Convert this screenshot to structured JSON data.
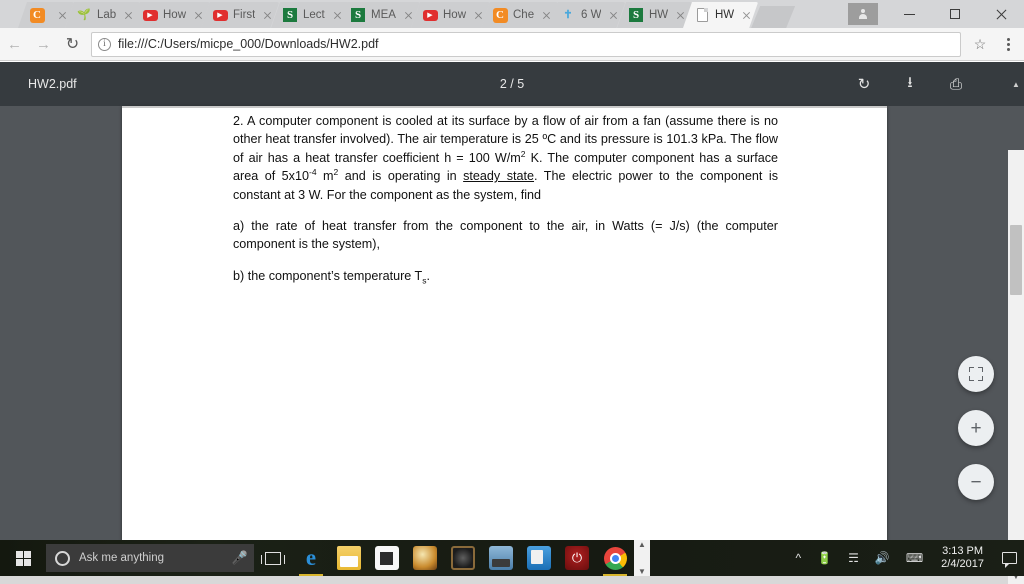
{
  "browser": {
    "tabs": [
      {
        "title": "",
        "favicon": "chegg-icon",
        "active": false
      },
      {
        "title": "Lab",
        "favicon": "lab-icon",
        "active": false
      },
      {
        "title": "How",
        "favicon": "youtube-icon",
        "active": false
      },
      {
        "title": "First",
        "favicon": "youtube-icon",
        "active": false
      },
      {
        "title": "Lect",
        "favicon": "sparknotes-icon",
        "active": false
      },
      {
        "title": "MEA",
        "favicon": "sparknotes-icon",
        "active": false
      },
      {
        "title": "How",
        "favicon": "youtube-icon",
        "active": false
      },
      {
        "title": "Che",
        "favicon": "chegg-icon",
        "active": false
      },
      {
        "title": "6 W",
        "favicon": "cross-icon",
        "active": false
      },
      {
        "title": "HW",
        "favicon": "sparknotes-icon",
        "active": false
      },
      {
        "title": "HW",
        "favicon": "document-icon",
        "active": true
      }
    ],
    "window_controls": {
      "minimize": "minimize-button",
      "maximize": "maximize-button",
      "close": "close-button",
      "profile": "profile-button"
    },
    "nav": {
      "back": "back-button",
      "forward": "forward-button",
      "reload": "reload-button",
      "bookmark": "bookmark-star",
      "menu": "chrome-menu"
    },
    "omnibox": {
      "url": "file:///C:/Users/micpe_000/Downloads/HW2.pdf",
      "security_icon": "info-icon"
    }
  },
  "pdf": {
    "filename": "HW2.pdf",
    "page_indicator": "2 / 5",
    "current_page": 2,
    "total_pages": 5,
    "tools": {
      "rotate": "rotate-icon",
      "download": "download-icon",
      "print": "print-icon"
    },
    "zoom_controls": {
      "fit": "fit-to-page-button",
      "zoom_in": "+",
      "zoom_out": "−"
    },
    "content": {
      "problem_number": "2.",
      "paragraph_1_a": "2. A computer component is cooled at its surface by a flow of air from a fan (assume there is no other heat transfer involved). The air temperature is 25 ",
      "paragraph_1_b": "C and its pressure is 101.3 kPa. The flow of air has a heat transfer coefficient h = 100 W/m",
      "paragraph_1_c": " K. The computer component has a surface area of 5x10",
      "paragraph_1_d": " m",
      "paragraph_1_e": " and is operating in ",
      "steady_state": "steady state",
      "paragraph_1_f": ". The electric power to the component is constant at 3 W. For the component as the system, find",
      "degree_symbol": "º",
      "exp_2": "2",
      "exp_neg4": "-4",
      "part_a": "a) the rate of heat transfer from the component to the air, in Watts (= J/s) (the computer component is the system),",
      "part_b_pre": "b) the component’s temperature T",
      "part_b_sub": "s",
      "part_b_post": "."
    }
  },
  "taskbar": {
    "start": "start-button",
    "search": {
      "placeholder": "Ask me anything",
      "mic": "microphone-icon",
      "cortana": "cortana-circle"
    },
    "task_view": "task-view-button",
    "pinned": [
      {
        "name": "microsoft-edge",
        "running": true
      },
      {
        "name": "file-explorer",
        "running": false
      },
      {
        "name": "microsoft-store",
        "running": false
      },
      {
        "name": "photo-viewer",
        "running": false
      },
      {
        "name": "audio-app",
        "running": false
      },
      {
        "name": "box-sync",
        "running": false
      },
      {
        "name": "blue-document-app",
        "running": false
      },
      {
        "name": "power-app",
        "running": false
      },
      {
        "name": "google-chrome",
        "running": true
      }
    ],
    "tray": {
      "show_hidden": "show-hidden-icons",
      "battery": "battery-icon",
      "wifi": "wifi-icon",
      "volume": "volume-icon",
      "keyboard": "keyboard-icon",
      "time": "3:13 PM",
      "date": "2/4/2017",
      "action_center": "action-center-icon"
    }
  },
  "colors": {
    "pdf_toolbar_bg": "#363b3f",
    "pdf_viewer_bg": "#52565a",
    "chrome_tabstrip_bg": "#d5d6d8",
    "chrome_toolbar_bg": "#f5f5f5",
    "taskbar_bg": "#1a1f16",
    "accent": "#4285f4"
  }
}
